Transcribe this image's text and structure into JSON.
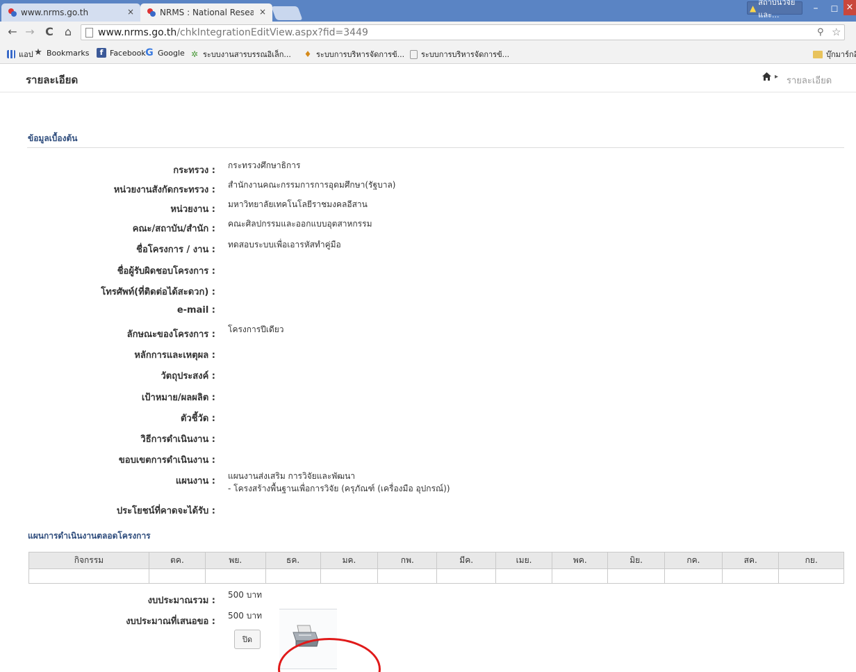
{
  "browser": {
    "tabs": [
      {
        "title": "www.nrms.go.th",
        "close": "×"
      },
      {
        "title": "NRMS : National Research",
        "close": "×"
      }
    ],
    "notification": "สถาบันวิจัยและ...",
    "window_controls": {
      "minimize": "–",
      "maximize": "☐",
      "close": "×"
    },
    "nav": {
      "back": "←",
      "forward": "→",
      "reload": "C",
      "home": "⌂"
    },
    "url_host": "www.nrms.go.th",
    "url_path": "/chkIntegrationEditView.aspx?fid=3449",
    "bookmarks": [
      {
        "label": "แอป",
        "icon": "apps-icon"
      },
      {
        "label": "Bookmarks",
        "icon": "star-icon"
      },
      {
        "label": "Facebook",
        "icon": "facebook-icon"
      },
      {
        "label": "Google",
        "icon": "google-icon"
      },
      {
        "label": "ระบบงานสารบรรณอิเล็ก...",
        "icon": "saraban-icon"
      },
      {
        "label": "ระบบการบริหารจัดการข้...",
        "icon": "candle-icon"
      },
      {
        "label": "ระบบการบริหารจัดการข้...",
        "icon": "page-icon"
      }
    ],
    "bookmarks_other": "บุ๊กมาร์กอื่",
    "colors": {
      "tabstrip": "#5a84c4",
      "close": "#c9473c"
    }
  },
  "page": {
    "title": "รายละเอียด",
    "breadcrumb": {
      "home_icon": "home-icon",
      "separator": "▸",
      "current": "รายละเอียด"
    },
    "section1_title": "ข้อมูลเบื้องต้น",
    "fields": [
      {
        "label": "กระทรวง :",
        "value": "กระทรวงศึกษาธิการ"
      },
      {
        "label": "หน่วยงานสังกัดกระทรวง :",
        "value": "สำนักงานคณะกรรมการการอุดมศึกษา(รัฐบาล)"
      },
      {
        "label": "หน่วยงาน :",
        "value": "มหาวิทยาลัยเทคโนโลยีราชมงคลอีสาน"
      },
      {
        "label": "คณะ/สถาบัน/สำนัก :",
        "value": "คณะศิลปกรรมและออกแบบอุตสาหกรรม"
      },
      {
        "label": "ชื่อโครงการ / งาน :",
        "value": "ทดสอบระบบเพื่อเอารหัสทำคู่มือ"
      },
      {
        "label": "ชื่อผู้รับผิดชอบโครงการ :",
        "value": ""
      },
      {
        "label": "โทรศัพท์(ที่ติดต่อได้สะดวก) :",
        "value": ""
      },
      {
        "label": "e-mail :",
        "value": ""
      },
      {
        "label": "ลักษณะของโครงการ :",
        "value": "โครงการปีเดียว"
      },
      {
        "label": "หลักการและเหตุผล :",
        "value": ""
      },
      {
        "label": "วัตถุประสงค์ :",
        "value": ""
      },
      {
        "label": "เป้าหมาย/ผลผลิต :",
        "value": ""
      },
      {
        "label": "ตัวชี้วัด :",
        "value": ""
      },
      {
        "label": "วิธีการดำเนินงาน :",
        "value": ""
      },
      {
        "label": "ขอบเขตการดำเนินงาน :",
        "value": ""
      },
      {
        "label": "แผนงาน :",
        "value": "แผนงานส่งเสริม การวิจัยและพัฒนา",
        "value2": "- โครงสร้างพื้นฐานเพื่อการวิจัย (ครุภัณฑ์ (เครื่องมือ อุปกรณ์))"
      },
      {
        "label": "ประโยชน์ที่คาดจะได้รับ :",
        "value": ""
      }
    ],
    "section2_title": "แผนการดำเนินงานตลอดโครงการ",
    "schedule_headers": [
      "กิจกรรม",
      "ตค.",
      "พย.",
      "ธค.",
      "มค.",
      "กพ.",
      "มีค.",
      "เมย.",
      "พค.",
      "มิย.",
      "กค.",
      "สค.",
      "กย."
    ],
    "budget_total_label": "งบประมาณรวม :",
    "budget_total_value": "500 บาท",
    "budget_request_label": "งบประมาณที่เสนอขอ :",
    "budget_request_value": "500 บาท",
    "close_button": "ปิด",
    "printer_icon": "printer-icon",
    "annotation_color": "#e01a1a"
  }
}
